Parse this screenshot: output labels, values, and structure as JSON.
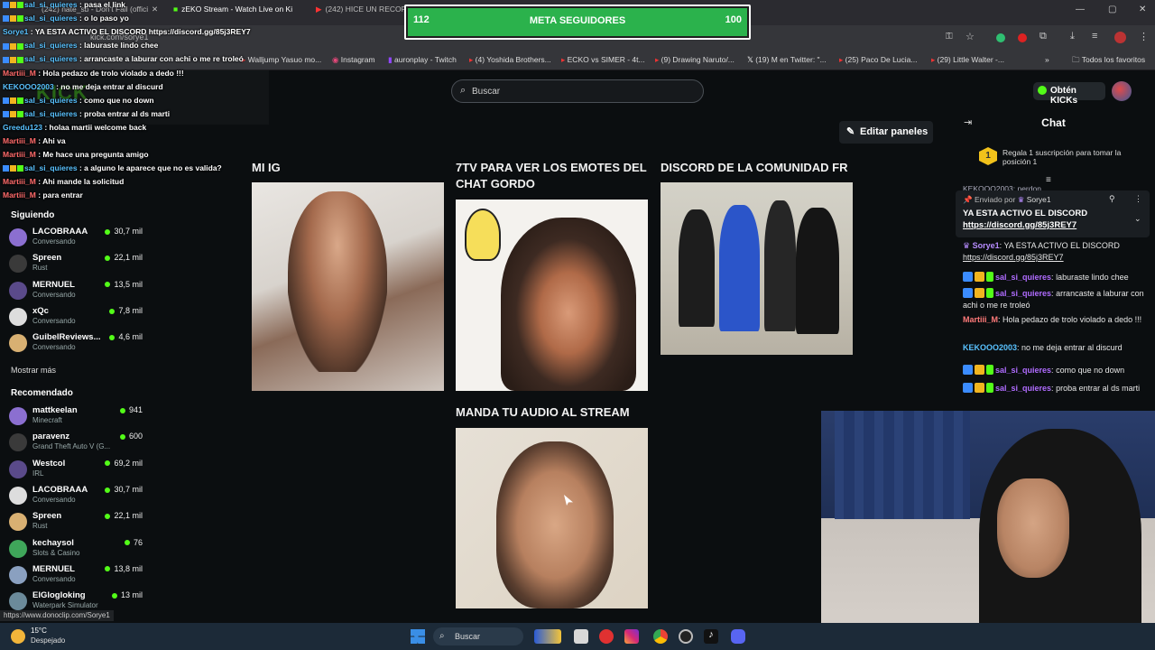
{
  "browser": {
    "tabs": [
      "(242) nate_sb - Don't Fall (offici",
      "zEKO Stream - Watch Live on Ki",
      "(242) HICE UN RECORD"
    ],
    "url": "kick.com/sorye1",
    "bookmarks": [
      "Walljump Yasuo mo...",
      "Instagram",
      "auronplay - Twitch",
      "(4) Yoshida Brothers...",
      "ECKO vs SIMER - 4t...",
      "(9) Drawing Naruto/...",
      "(19) M en Twitter: \"...",
      "(25) Paco De Lucia...",
      "(29) Little Walter -...",
      "Todos los favoritos"
    ]
  },
  "header": {
    "search_placeholder": "Buscar",
    "kicks_button": "Obtén KICKs",
    "logo": "KICK"
  },
  "goal": {
    "left": "112",
    "title": "META SEGUIDORES",
    "right": "100",
    "progress": 1.0
  },
  "overlay_chat": [
    {
      "user": "sal_si_quieres",
      "text": "pasa el link"
    },
    {
      "user": "sal_si_quieres",
      "text": "o lo paso yo"
    },
    {
      "user": "Sorye1",
      "text": "YA ESTA ACTIVO EL DISCORD https://discord.gg/85j3REY7"
    },
    {
      "user": "sal_si_quieres",
      "text": "laburaste lindo chee"
    },
    {
      "user": "sal_si_quieres",
      "text": "arrancaste a laburar con achi o me re troleó"
    },
    {
      "user": "Martiii_M",
      "text": "Hola pedazo de trolo violado a dedo !!!"
    },
    {
      "user": "KEKOOO2003",
      "text": "no me deja entrar al discurd"
    },
    {
      "user": "sal_si_quieres",
      "text": "como que no down"
    },
    {
      "user": "sal_si_quieres",
      "text": "proba entrar al ds marti"
    },
    {
      "user": "Greedu123",
      "text": "holaa martii welcome back"
    },
    {
      "user": "Martiii_M",
      "text": "Ahi va"
    },
    {
      "user": "Martiii_M",
      "text": "Me hace una pregunta amigo"
    },
    {
      "user": "sal_si_quieres",
      "text": "a alguno le aparece que no es valida?"
    },
    {
      "user": "Martiii_M",
      "text": "Ahi mande la solicitud"
    },
    {
      "user": "Martiii_M",
      "text": "para entrar"
    }
  ],
  "sidebar": {
    "following_title": "Siguiendo",
    "following": [
      {
        "name": "LACOBRAAA",
        "sub": "Conversando",
        "viewers": "30,7 mil"
      },
      {
        "name": "Spreen",
        "sub": "Rust",
        "viewers": "22,1 mil"
      },
      {
        "name": "MERNUEL",
        "sub": "Conversando",
        "viewers": "13,5 mil"
      },
      {
        "name": "xQc",
        "sub": "Conversando",
        "viewers": "7,8 mil"
      },
      {
        "name": "GuibelReviews...",
        "sub": "Conversando",
        "viewers": "4,6 mil"
      }
    ],
    "show_more": "Mostrar más",
    "recommended_title": "Recomendado",
    "recommended": [
      {
        "name": "mattkeelan",
        "sub": "Minecraft",
        "viewers": "941"
      },
      {
        "name": "paravenz",
        "sub": "Grand Theft Auto V (G...",
        "viewers": "600"
      },
      {
        "name": "Westcol",
        "sub": "IRL",
        "viewers": "69,2 mil"
      },
      {
        "name": "LACOBRAAA",
        "sub": "Conversando",
        "viewers": "30,7 mil"
      },
      {
        "name": "Spreen",
        "sub": "Rust",
        "viewers": "22,1 mil"
      },
      {
        "name": "kechaysol",
        "sub": "Slots & Casino",
        "viewers": "76"
      },
      {
        "name": "MERNUEL",
        "sub": "Conversando",
        "viewers": "13,8 mil"
      },
      {
        "name": "ElGlogloking",
        "sub": "Waterpark Simulator",
        "viewers": "13 mil"
      }
    ],
    "status_url": "https://www.donoclip.com/Sorye1"
  },
  "panels": {
    "edit_button": "Editar paneles",
    "items": [
      {
        "title": "MI IG"
      },
      {
        "title": "7TV PARA VER LOS EMOTES DEL CHAT GORDO"
      },
      {
        "title": "DISCORD DE LA COMUNIDAD FR"
      },
      {
        "title": "MANDA TU AUDIO AL STREAM"
      }
    ]
  },
  "chat": {
    "title": "Chat",
    "gift_text": "Regala 1 suscripción para tomar la posición 1",
    "gift_rank": "1",
    "pinned": {
      "by_label": "Enviado por",
      "by_user": "Sorye1",
      "text": "YA ESTA ACTIVO EL DISCORD",
      "link": "https://discord.gg/85j3REY7"
    },
    "partial_top": "KEKOOO2003: perdon",
    "messages": [
      {
        "user": "Sorye1",
        "text": "YA ESTA ACTIVO EL DISCORD",
        "link": "https://discord.gg/85j3REY7",
        "color": "#b78cff"
      },
      {
        "user": "sal_si_quieres",
        "text": "laburaste lindo chee",
        "color": "#b06cff"
      },
      {
        "user": "sal_si_quieres",
        "text": "arrancaste a laburar con achi o me re troleó",
        "color": "#b06cff"
      },
      {
        "user": "Martiii_M",
        "text": "Hola pedazo de trolo violado a dedo !!!",
        "color": "#ff7a7a"
      },
      {
        "user": "KEKOOO2003",
        "text": "no me deja entrar al discurd",
        "color": "#59c2ff"
      },
      {
        "user": "sal_si_quieres",
        "text": "como que no down",
        "color": "#b06cff"
      },
      {
        "user": "sal_si_quieres",
        "text": "proba entrar al ds marti",
        "color": "#b06cff"
      }
    ]
  },
  "taskbar": {
    "weather_temp": "15°C",
    "weather_desc": "Despejado",
    "search_placeholder": "Buscar"
  },
  "colors": {
    "kick_green": "#53fc18",
    "goal_green": "#2bb24c"
  }
}
